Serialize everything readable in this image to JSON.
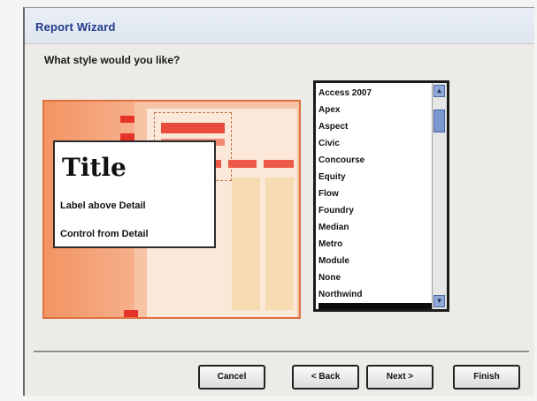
{
  "window": {
    "title": "Report Wizard"
  },
  "prompt": "What style would you like?",
  "preview": {
    "title_text": "Title",
    "label_text": "Label above Detail",
    "control_text": "Control from Detail"
  },
  "styles": {
    "items": [
      "Access 2007",
      "Apex",
      "Aspect",
      "Civic",
      "Concourse",
      "Equity",
      "Flow",
      "Foundry",
      "Median",
      "Metro",
      "Module",
      "None",
      "Northwind",
      ""
    ],
    "selected_index": 13
  },
  "buttons": {
    "cancel": "Cancel",
    "back": "< Back",
    "next": "Next >",
    "finish": "Finish"
  },
  "colors": {
    "accent": "#e6332a",
    "preview_background": "#f6c3a4",
    "title_text": "#1f3a8a"
  }
}
